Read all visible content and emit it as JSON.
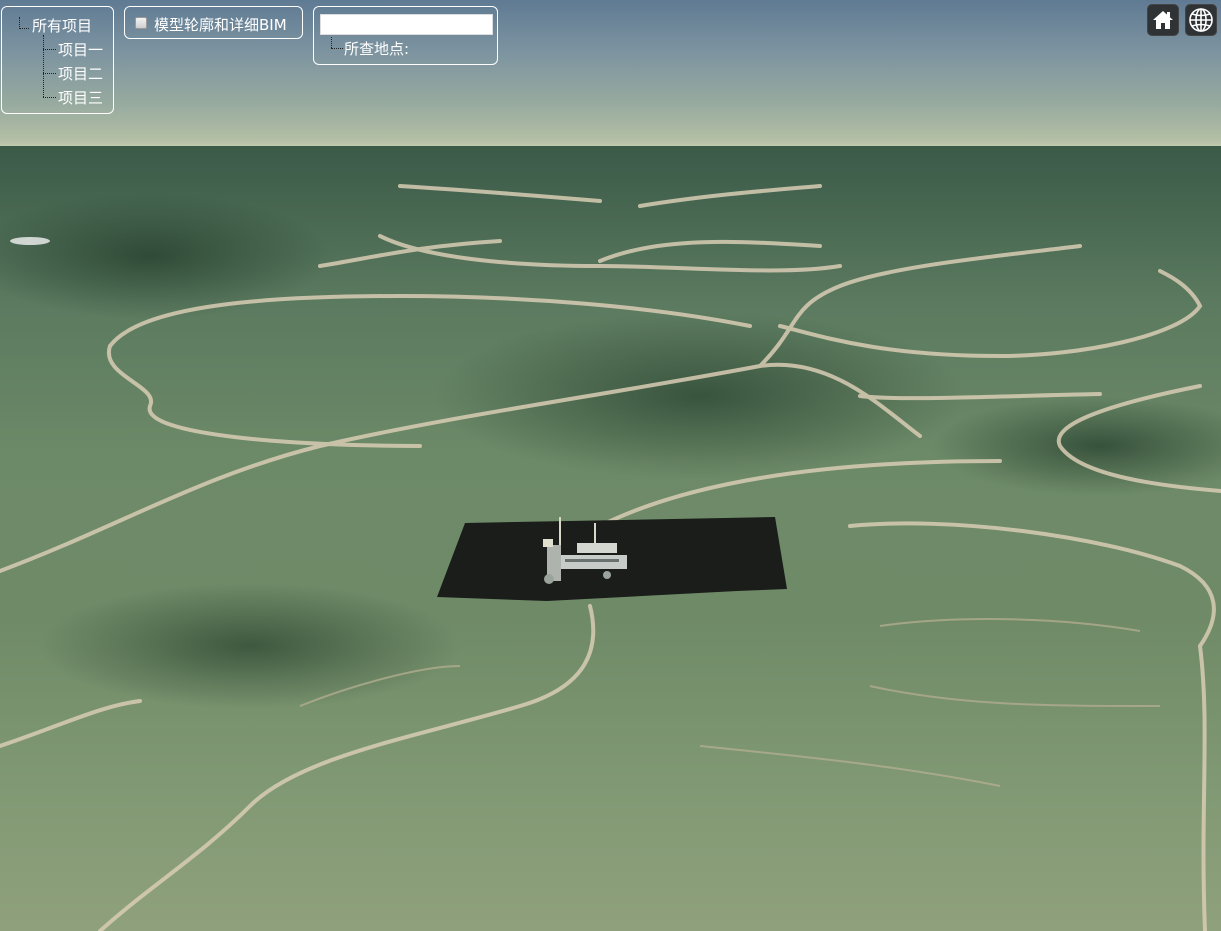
{
  "project_tree": {
    "root_label": "所有项目",
    "items": [
      {
        "label": "项目一"
      },
      {
        "label": "项目二"
      },
      {
        "label": "项目三"
      }
    ]
  },
  "bim_toggle": {
    "label": "模型轮廓和详细BIM",
    "checked": false
  },
  "search": {
    "input_value": "",
    "result_label": "所查地点:"
  },
  "toolbar": {
    "home_icon": "home-icon",
    "globe_icon": "globe-icon"
  },
  "colors": {
    "panel_border": "#ffffff",
    "panel_text": "#ffffff",
    "toolbar_bg": "#303336"
  }
}
